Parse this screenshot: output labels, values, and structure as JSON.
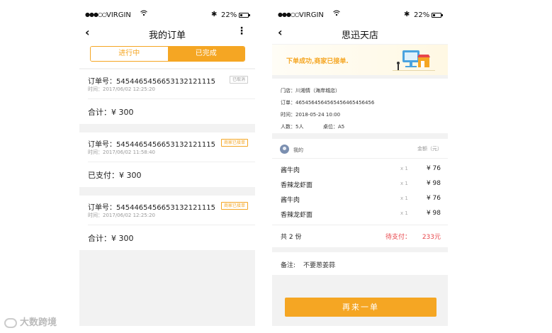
{
  "status_bar": {
    "signal": "●●●○○",
    "carrier": "VIRGIN",
    "wifi_icon": "wifi-icon",
    "bluetooth_icon": "bluetooth-icon",
    "battery": "22%"
  },
  "left": {
    "title": "我的订单",
    "back": "‹",
    "more": "⋮",
    "tabs": [
      {
        "label": "进行中",
        "active": false
      },
      {
        "label": "已完成",
        "active": true
      }
    ],
    "orders": [
      {
        "no": "订单号：5454465456653132121115",
        "time": "时间：2017/06/02  12:25:20",
        "badge": "已取消",
        "sum": "合计：¥ 300"
      },
      {
        "no": "订单号：5454465456653132121115",
        "time": "时间：2017/06/02  11:58:40",
        "badge": "商家已接单",
        "sum": "已支付：¥ 300"
      },
      {
        "no": "订单号：5454465456653132121115",
        "time": "时间：2017/06/02  12:25:20",
        "badge": "商家已接单",
        "sum": "合计：¥ 300"
      }
    ]
  },
  "right": {
    "title": "思迅天店",
    "back": "‹",
    "banner": "下单成功,商家已接单.",
    "info": {
      "store": "门店：川湘情（海岸城店）",
      "order": "订单：4654564564565456465456456",
      "time": "时间：2018-05-24   10:00",
      "people": "人数：5人",
      "table": "桌位：A5"
    },
    "me": "我的",
    "amount_header": "金额（元）",
    "items": [
      {
        "name": "酱牛肉",
        "qty": "x 1",
        "price": "¥ 76"
      },
      {
        "name": "香辣龙虾面",
        "qty": "x 1",
        "price": "¥ 98"
      },
      {
        "name": "酱牛肉",
        "qty": "x 1",
        "price": "¥ 76"
      },
      {
        "name": "香辣龙虾面",
        "qty": "x 1",
        "price": "¥ 98"
      }
    ],
    "count": "共 2 份",
    "due_label": "待支付：",
    "due_amount": "233元",
    "remark_label": "备注:",
    "remark_value": "不要葱姜蒜",
    "again_button": "再来一单"
  },
  "watermark": "大数跨境",
  "colors": {
    "accent": "#f5a623",
    "danger": "#e8464b"
  }
}
